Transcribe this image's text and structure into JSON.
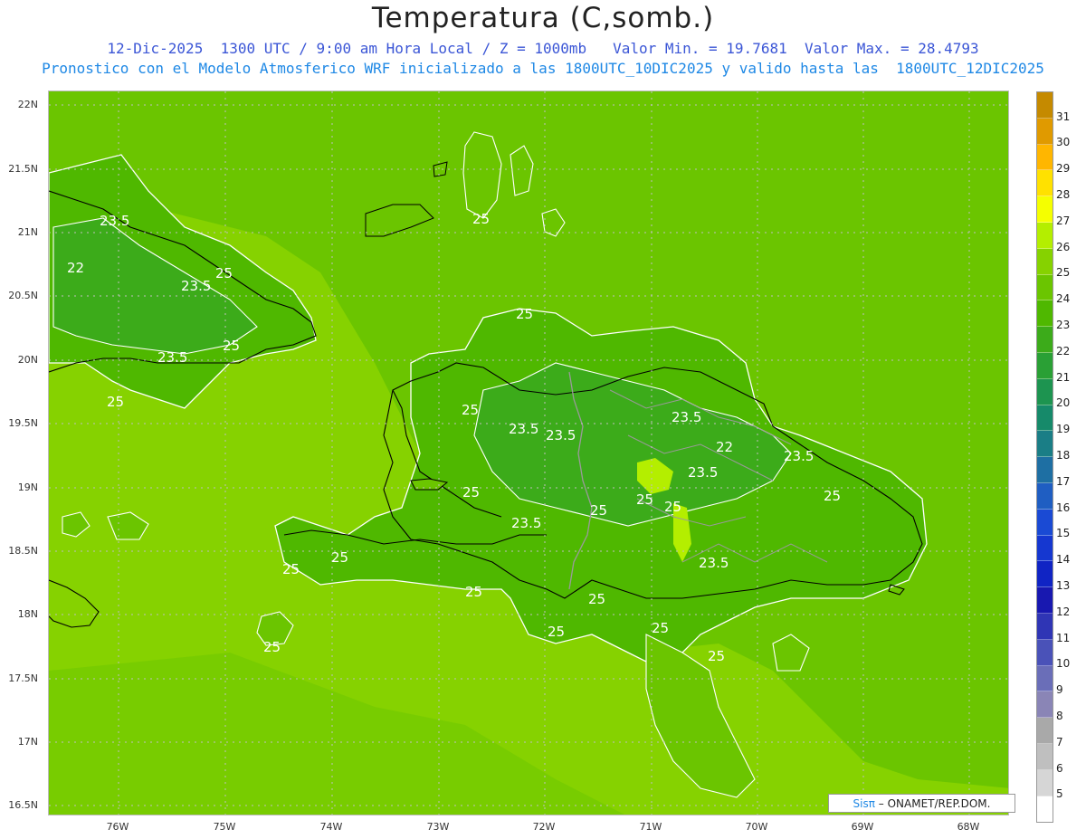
{
  "header": {
    "title": "Temperatura (C,somb.)",
    "line1": "12-Dic-2025  1300 UTC / 9:00 am Hora Local / Z = 1000mb   Valor Min. = 19.7681  Valor Max. = 28.4793",
    "line2": "Pronostico con el Modelo Atmosferico WRF inicializado a las 1800UTC_10DIC2025 y valido hasta las  1800UTC_12DIC2025"
  },
  "axes": {
    "lat_labels": [
      "22N",
      "21.5N",
      "21N",
      "20.5N",
      "20N",
      "19.5N",
      "19N",
      "18.5N",
      "18N",
      "17.5N",
      "17N",
      "16.5N"
    ],
    "lon_labels": [
      "76W",
      "75W",
      "74W",
      "73W",
      "72W",
      "71W",
      "70W",
      "69W",
      "68W"
    ]
  },
  "contour_labels": [
    "25",
    "23.5",
    "22",
    "23.5",
    "25",
    "25",
    "23.5",
    "25",
    "25",
    "25",
    "23.5",
    "23.5",
    "23.5",
    "22",
    "23.5",
    "23.5",
    "25",
    "25",
    "25",
    "23.5",
    "25",
    "25",
    "23.5",
    "25",
    "25",
    "25",
    "25",
    "25",
    "25",
    "25",
    "25"
  ],
  "colorbar": {
    "labels": [
      "31",
      "30",
      "29",
      "28",
      "27",
      "26",
      "25",
      "24",
      "23",
      "22",
      "21",
      "20",
      "19",
      "18",
      "17",
      "16",
      "15",
      "14",
      "13",
      "12",
      "11",
      "10",
      "9",
      "8",
      "7",
      "6",
      "5"
    ],
    "colors": [
      "#c58a00",
      "#e09a00",
      "#ffb600",
      "#ffe100",
      "#f5ff00",
      "#b4ee00",
      "#86d200",
      "#6bc500",
      "#4fb800",
      "#3cab1a",
      "#2aa035",
      "#1d9450",
      "#168a6a",
      "#1a7e86",
      "#1e6fa3",
      "#1f5ec2",
      "#1a4ad4",
      "#1537d0",
      "#1024c4",
      "#1818b0",
      "#2f35b5",
      "#4a52b8",
      "#6a6eb8",
      "#8a85b6",
      "#a9a9a9",
      "#bfbfbf",
      "#d6d6d6",
      "#ffffff"
    ]
  },
  "credit": {
    "brand": "Sisπ",
    "text": " – ONAMET/REP.DOM."
  }
}
